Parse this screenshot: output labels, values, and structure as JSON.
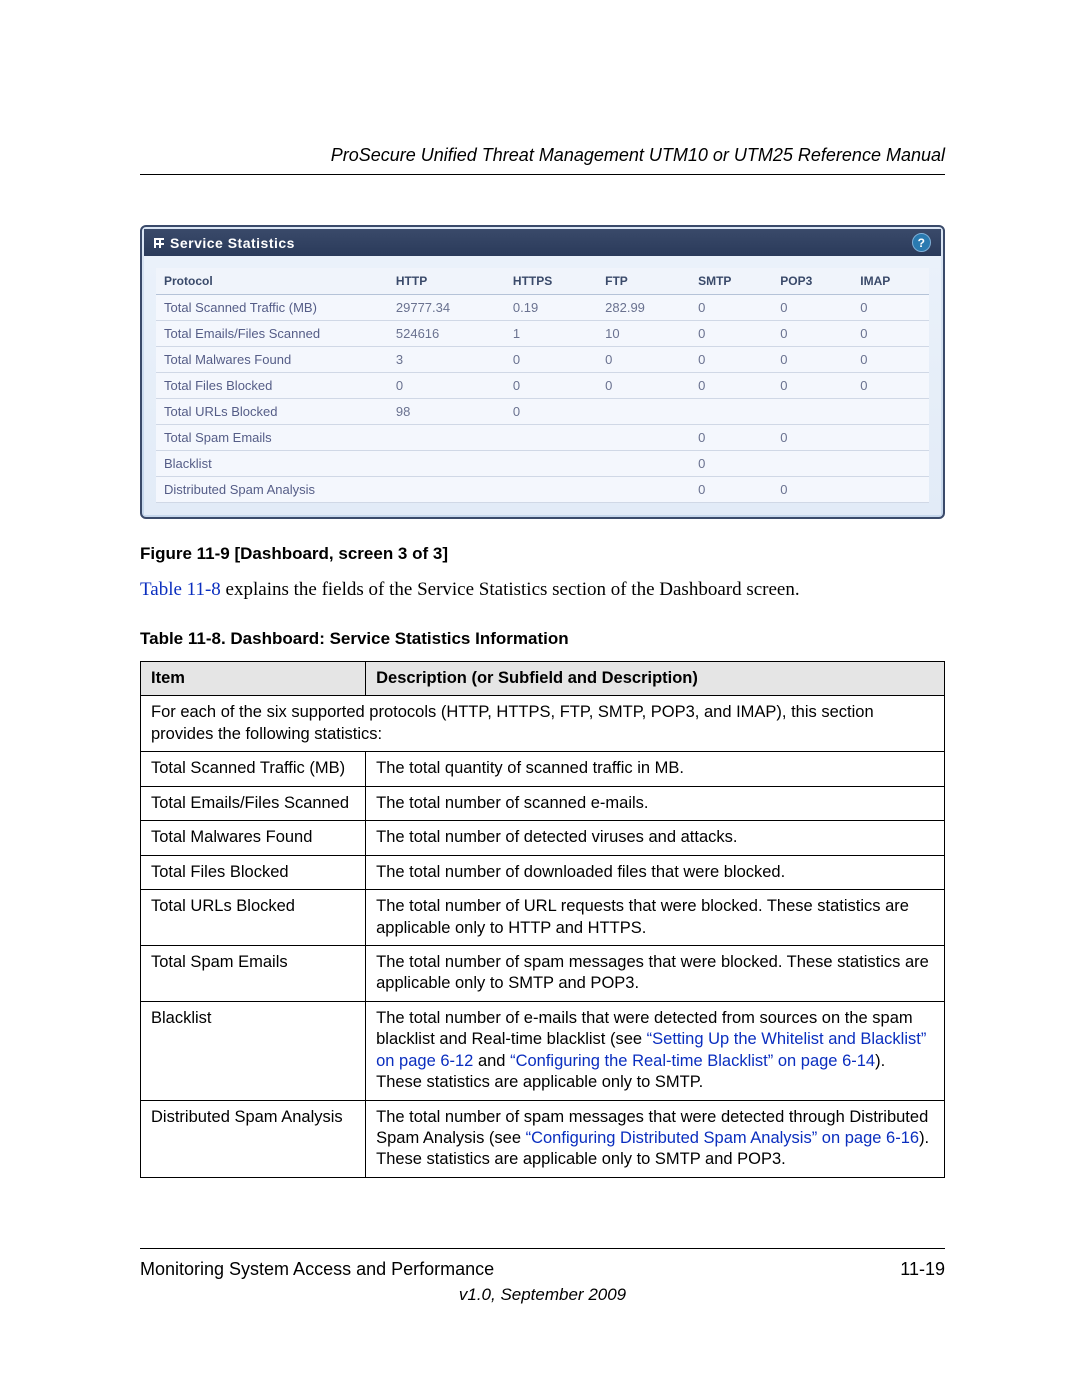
{
  "header": {
    "title": "ProSecure Unified Threat Management UTM10 or UTM25 Reference Manual"
  },
  "screenshot": {
    "panel_title": "Service Statistics",
    "table": {
      "headers": [
        "Protocol",
        "HTTP",
        "HTTPS",
        "FTP",
        "SMTP",
        "POP3",
        "IMAP"
      ],
      "rows": [
        {
          "label": "Total Scanned Traffic (MB)",
          "cells": [
            "29777.34",
            "0.19",
            "282.99",
            "0",
            "0",
            "0"
          ]
        },
        {
          "label": "Total Emails/Files Scanned",
          "cells": [
            "524616",
            "1",
            "10",
            "0",
            "0",
            "0"
          ]
        },
        {
          "label": "Total Malwares Found",
          "cells": [
            "3",
            "0",
            "0",
            "0",
            "0",
            "0"
          ]
        },
        {
          "label": "Total Files Blocked",
          "cells": [
            "0",
            "0",
            "0",
            "0",
            "0",
            "0"
          ]
        },
        {
          "label": "Total URLs Blocked",
          "cells": [
            "98",
            "0",
            "",
            "",
            "",
            ""
          ]
        },
        {
          "label": "Total Spam Emails",
          "cells": [
            "",
            "",
            "",
            "0",
            "0",
            ""
          ]
        },
        {
          "label": "Blacklist",
          "cells": [
            "",
            "",
            "",
            "0",
            "",
            ""
          ]
        },
        {
          "label": "Distributed Spam Analysis",
          "cells": [
            "",
            "",
            "",
            "0",
            "0",
            ""
          ]
        }
      ]
    }
  },
  "figure_caption": "Figure 11-9 [Dashboard, screen 3 of 3]",
  "body": {
    "link": "Table 11-8",
    "rest": " explains the fields of the Service Statistics section of the Dashboard screen."
  },
  "defs_caption": "Table 11-8. Dashboard: Service Statistics Information",
  "defs": {
    "head_item": "Item",
    "head_desc": "Description (or Subfield and Description)",
    "intro": "For each of the six supported protocols (HTTP, HTTPS, FTP, SMTP, POP3, and IMAP), this section provides the following statistics:",
    "rows": [
      {
        "item": "Total Scanned Traffic (MB)",
        "desc": "The total quantity of scanned traffic in MB."
      },
      {
        "item": "Total Emails/Files Scanned",
        "desc": "The total number of scanned e-mails."
      },
      {
        "item": "Total Malwares Found",
        "desc": "The total number of detected viruses and attacks."
      },
      {
        "item": "Total Files Blocked",
        "desc": "The total number of downloaded files that were blocked."
      },
      {
        "item": "Total URLs Blocked",
        "desc": "The total number of URL requests that were blocked. These statistics are applicable only to HTTP and HTTPS."
      },
      {
        "item": "Total Spam Emails",
        "desc": "The total number of spam messages that were blocked. These statistics are applicable only to SMTP and POP3."
      }
    ],
    "blacklist": {
      "item": "Blacklist",
      "pre": "The total number of e-mails that were detected from sources on the spam blacklist and Real-time blacklist (see ",
      "link1": "“Setting Up the Whitelist and Blacklist” on page 6-12",
      "mid": " and ",
      "link2": "“Configuring the Real-time Blacklist” on page 6-14",
      "post": "). These statistics are applicable only to SMTP."
    },
    "dsa": {
      "item": "Distributed Spam Analysis",
      "pre": "The total number of spam messages that were detected through Distributed Spam Analysis (see ",
      "link": "“Configuring Distributed Spam Analysis” on page 6-16",
      "post": "). These statistics are applicable only to SMTP and POP3."
    }
  },
  "footer": {
    "left": "Monitoring System Access and Performance",
    "right": "11-19",
    "version": "v1.0, September 2009"
  }
}
